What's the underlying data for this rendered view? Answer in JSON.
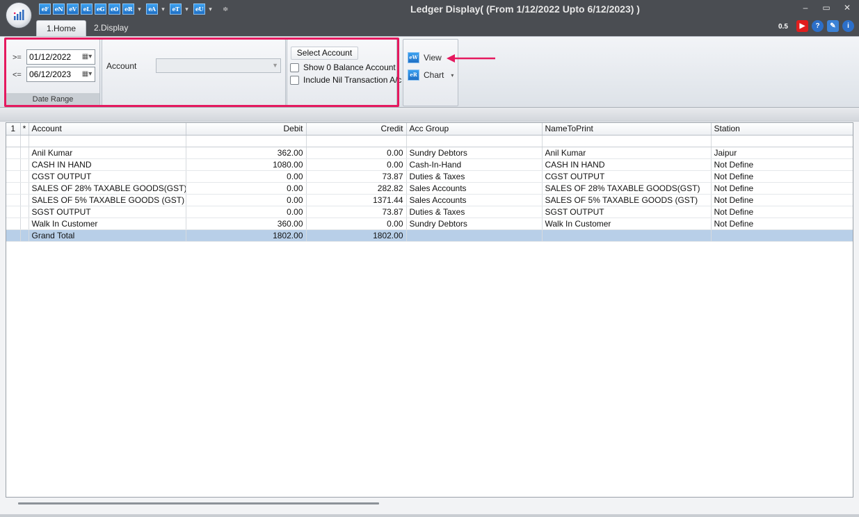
{
  "window": {
    "title": "Ledger Display( (From 1/12/2022 Upto 6/12/2023) )",
    "controls": [
      "–",
      "▭",
      "✕"
    ]
  },
  "quick_access": [
    {
      "label": "eF",
      "dropdown": false
    },
    {
      "label": "eN",
      "dropdown": false
    },
    {
      "label": "eV",
      "dropdown": false
    },
    {
      "label": "eL",
      "dropdown": false
    },
    {
      "label": "eG",
      "dropdown": false
    },
    {
      "label": "eO",
      "dropdown": false
    },
    {
      "label": "eR",
      "dropdown": true
    },
    {
      "label": "eA",
      "dropdown": true
    },
    {
      "label": "eT",
      "dropdown": true
    },
    {
      "label": "eU",
      "dropdown": true
    }
  ],
  "tabs": [
    {
      "label": "1.Home",
      "active": true
    },
    {
      "label": "2.Display",
      "active": false
    }
  ],
  "top_right": {
    "version": "0.5",
    "icons": [
      "youtube-icon",
      "help-icon",
      "notes-icon",
      "info-icon"
    ]
  },
  "date_range": {
    "from_operator": ">=",
    "from_value": "01/12/2022",
    "to_operator": "<=",
    "to_value": "06/12/2023",
    "caption": "Date Range"
  },
  "account": {
    "label": "Account",
    "value": ""
  },
  "options": {
    "select_account_label": "Select Account",
    "show_zero_balance_label": "Show 0 Balance Account",
    "show_zero_balance_checked": false,
    "include_nil_label": "Include Nil Transaction A/c",
    "include_nil_checked": false
  },
  "actions": {
    "view_label": "View",
    "view_icon": "eW",
    "chart_label": "Chart",
    "chart_icon": "eR"
  },
  "colors": {
    "highlight": "#e5195f",
    "titlebar": "#4a4d52",
    "total_row": "#b8cfe8"
  },
  "grid": {
    "columns": {
      "rownum": "1",
      "marker": "*",
      "account": "Account",
      "debit": "Debit",
      "credit": "Credit",
      "acc_group": "Acc Group",
      "name_to_print": "NameToPrint",
      "station": "Station"
    },
    "rows": [
      {
        "account": "Anil Kumar",
        "debit": "362.00",
        "credit": "0.00",
        "acc_group": "Sundry Debtors",
        "name_to_print": "Anil Kumar",
        "station": "Jaipur"
      },
      {
        "account": "CASH IN HAND",
        "debit": "1080.00",
        "credit": "0.00",
        "acc_group": "Cash-In-Hand",
        "name_to_print": "CASH IN HAND",
        "station": "Not Define"
      },
      {
        "account": "CGST OUTPUT",
        "debit": "0.00",
        "credit": "73.87",
        "acc_group": "Duties & Taxes",
        "name_to_print": "CGST OUTPUT",
        "station": "Not Define"
      },
      {
        "account": "SALES OF 28% TAXABLE GOODS(GST)",
        "debit": "0.00",
        "credit": "282.82",
        "acc_group": "Sales Accounts",
        "name_to_print": "SALES OF 28% TAXABLE GOODS(GST)",
        "station": "Not Define"
      },
      {
        "account": "SALES OF 5% TAXABLE GOODS (GST)",
        "debit": "0.00",
        "credit": "1371.44",
        "acc_group": "Sales Accounts",
        "name_to_print": "SALES OF 5% TAXABLE GOODS (GST)",
        "station": "Not Define"
      },
      {
        "account": "SGST OUTPUT",
        "debit": "0.00",
        "credit": "73.87",
        "acc_group": "Duties & Taxes",
        "name_to_print": "SGST OUTPUT",
        "station": "Not Define"
      },
      {
        "account": "Walk In Customer",
        "debit": "360.00",
        "credit": "0.00",
        "acc_group": "Sundry Debtors",
        "name_to_print": "Walk In Customer",
        "station": "Not Define"
      }
    ],
    "total": {
      "account": "Grand Total",
      "debit": "1802.00",
      "credit": "1802.00"
    }
  }
}
